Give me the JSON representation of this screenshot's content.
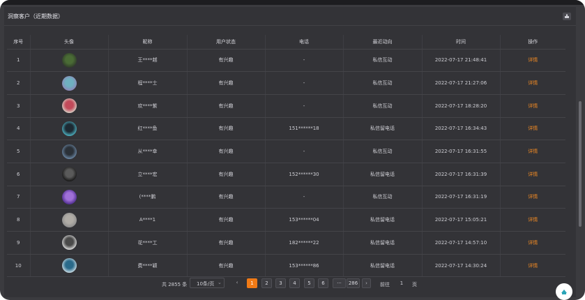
{
  "card": {
    "title": "洞察客户（近期数据）",
    "export_icon": "export-icon"
  },
  "table": {
    "columns": [
      "序号",
      "头像",
      "昵称",
      "用户状态",
      "电话",
      "最近动向",
      "时间",
      "操作"
    ],
    "rows": [
      {
        "index": "1",
        "avatar_colors": [
          "#2f3a2a",
          "#4a6b35"
        ],
        "nickname": "王****越",
        "status": "有兴趣",
        "phone": "-",
        "recent": "私信互动",
        "time": "2022-07-17 21:48:41",
        "action": "详情"
      },
      {
        "index": "2",
        "avatar_colors": [
          "#8e86b8",
          "#6fb0c0"
        ],
        "nickname": "程****士",
        "status": "有兴趣",
        "phone": "-",
        "recent": "私信互动",
        "time": "2022-07-17 21:27:06",
        "action": "详情"
      },
      {
        "index": "3",
        "avatar_colors": [
          "#d8d4c8",
          "#c24a5a"
        ],
        "nickname": "欢****紫",
        "status": "有兴趣",
        "phone": "-",
        "recent": "私信互动",
        "time": "2022-07-17 18:28:20",
        "action": "详情"
      },
      {
        "index": "4",
        "avatar_colors": [
          "#4fb7c7",
          "#1d2a33"
        ],
        "nickname": "红****鱼",
        "status": "有兴趣",
        "phone": "151******18",
        "recent": "私信留电话",
        "time": "2022-07-17 16:34:43",
        "action": "详情"
      },
      {
        "index": "5",
        "avatar_colors": [
          "#6d8aa8",
          "#2b3138"
        ],
        "nickname": "从****幸",
        "status": "有兴趣",
        "phone": "-",
        "recent": "私信互动",
        "time": "2022-07-17 16:31:55",
        "action": "详情"
      },
      {
        "index": "6",
        "avatar_colors": [
          "#141414",
          "#5a5a5a"
        ],
        "nickname": "立****宏",
        "status": "有兴趣",
        "phone": "152******30",
        "recent": "私信留电话",
        "time": "2022-07-17 16:31:39",
        "action": "详情"
      },
      {
        "index": "7",
        "avatar_colors": [
          "#4a2a8a",
          "#a070d8"
        ],
        "nickname": "(****鹏",
        "status": "有兴趣",
        "phone": "-",
        "recent": "私信互动",
        "time": "2022-07-17 16:31:19",
        "action": "详情"
      },
      {
        "index": "8",
        "avatar_colors": [
          "#8c8c8c",
          "#b0aca6"
        ],
        "nickname": "A****1",
        "status": "有兴趣",
        "phone": "153******04",
        "recent": "私信留电话",
        "time": "2022-07-17 15:05:21",
        "action": "详情"
      },
      {
        "index": "9",
        "avatar_colors": [
          "#e2e2e2",
          "#4a4a4a"
        ],
        "nickname": "花****工",
        "status": "有兴趣",
        "phone": "182******22",
        "recent": "私信留电话",
        "time": "2022-07-17 14:57:10",
        "action": "详情"
      },
      {
        "index": "10",
        "avatar_colors": [
          "#cfe0e8",
          "#2a6a8a"
        ],
        "nickname": "费****颖",
        "status": "有兴趣",
        "phone": "153******86",
        "recent": "私信留电话",
        "time": "2022-07-17 14:30:24",
        "action": "详情"
      }
    ]
  },
  "pagination": {
    "total_label": "共 2855 条",
    "page_size": "10条/页",
    "prev_icon": "chevron-left-icon",
    "next_icon": "chevron-right-icon",
    "pages": [
      "1",
      "2",
      "3",
      "4",
      "5",
      "6",
      "···",
      "286"
    ],
    "current_page": "1",
    "goto_label": "前往",
    "goto_value": "1",
    "page_unit": "页"
  },
  "colors": {
    "background": "#3b3b3f",
    "card": "#333337",
    "accent": "#f07a16",
    "link": "#f08a24"
  },
  "float_button_icon": "customer-service-icon"
}
